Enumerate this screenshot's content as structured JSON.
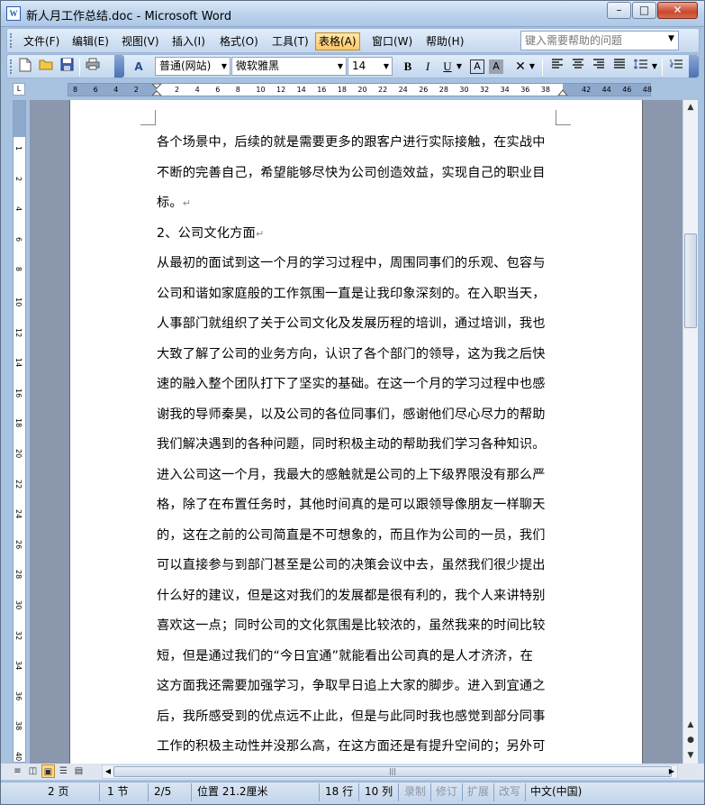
{
  "window": {
    "title": "新人月工作总结.doc - Microsoft Word",
    "app_icon": "W"
  },
  "caption_buttons": {
    "minimize": "–",
    "maximize": "□",
    "close": "✕"
  },
  "menu": {
    "items": [
      "文件(F)",
      "编辑(E)",
      "视图(V)",
      "插入(I)",
      "格式(O)",
      "工具(T)",
      "表格(A)",
      "窗口(W)",
      "帮助(H)"
    ],
    "active_index": 6,
    "help_placeholder": "键入需要帮助的问题"
  },
  "toolbar": {
    "style": "普通(网站)",
    "font": "微软雅黑",
    "size": "14",
    "bold": "B",
    "italic": "I",
    "underline": "U",
    "char_border": "A",
    "char_shading": "A"
  },
  "ruler": {
    "h_ticks": [
      "8",
      "6",
      "4",
      "2",
      "",
      "2",
      "4",
      "6",
      "8",
      "10",
      "12",
      "14",
      "16",
      "18",
      "20",
      "22",
      "24",
      "26",
      "28",
      "30",
      "32",
      "34",
      "36",
      "38",
      "",
      "42",
      "44",
      "46",
      "48"
    ],
    "v_ticks": [
      "1",
      "2",
      "4",
      "6",
      "8",
      "10",
      "12",
      "14",
      "16",
      "18",
      "20",
      "22",
      "24",
      "26",
      "28",
      "30",
      "32",
      "34",
      "36",
      "38",
      "40",
      "42"
    ]
  },
  "document": {
    "lines": [
      "各个场景中，后续的就是需要更多的跟客户进行实际接触，在实战中",
      "不断的完善自己，希望能够尽快为公司创造效益，实现自己的职业目",
      "标。",
      "2、公司文化方面",
      "从最初的面试到这一个月的学习过程中，周围同事们的乐观、包容与",
      "公司和谐如家庭般的工作氛围一直是让我印象深刻的。在入职当天，",
      "人事部门就组织了关于公司文化及发展历程的培训，通过培训，我也",
      "大致了解了公司的业务方向，认识了各个部门的领导，这为我之后快",
      "速的融入整个团队打下了坚实的基础。在这一个月的学习过程中也感",
      "谢我的导师秦昊，以及公司的各位同事们，感谢他们尽心尽力的帮助",
      "我们解决遇到的各种问题，同时积极主动的帮助我们学习各种知识。",
      "进入公司这一个月，我最大的感触就是公司的上下级界限没有那么严",
      "格，除了在布置任务时，其他时间真的是可以跟领导像朋友一样聊天",
      "的，这在之前的公司简直是不可想象的，而且作为公司的一员，我们",
      "可以直接参与到部门甚至是公司的决策会议中去，虽然我们很少提出",
      "什么好的建议，但是这对我们的发展都是很有利的，我个人来讲特别",
      "喜欢这一点；同时公司的文化氛围是比较浓的，虽然我来的时间比较",
      "短，但是通过我们的“今日宜通”就能看出公司真的是人才济济，在",
      "这方面我还需要加强学习，争取早日追上大家的脚步。进入到宜通之",
      "后，我所感受到的优点远不止此，但是与此同时我也感觉到部分同事",
      "工作的积极主动性并没那么高，在这方面还是有提升空间的；另外可"
    ],
    "paragraph_mark": "↵",
    "para_end_lines": [
      2,
      3
    ]
  },
  "status": {
    "page": "2 页",
    "section": "1 节",
    "page_of": "2/5",
    "position": "位置 21.2厘米",
    "line": "18 行",
    "col": "10 列",
    "rec": "录制",
    "trk": "修订",
    "ext": "扩展",
    "ovr": "改写",
    "lang": "中文(中国)"
  }
}
